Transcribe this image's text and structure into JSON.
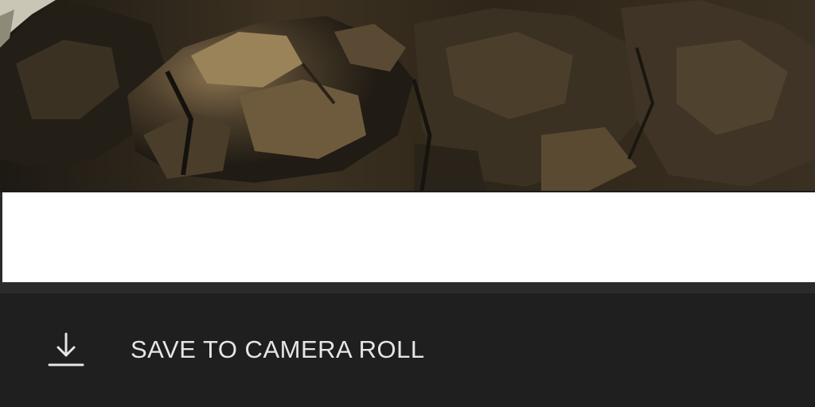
{
  "photo": {
    "description_icon": "rock-photo"
  },
  "actions": {
    "save_icon": "download-icon",
    "save_label": "SAVE TO CAMERA ROLL"
  },
  "colors": {
    "sheet_background": "#1f1f20",
    "separator": "#2b2b2c",
    "label_text": "#e6e6e6"
  }
}
